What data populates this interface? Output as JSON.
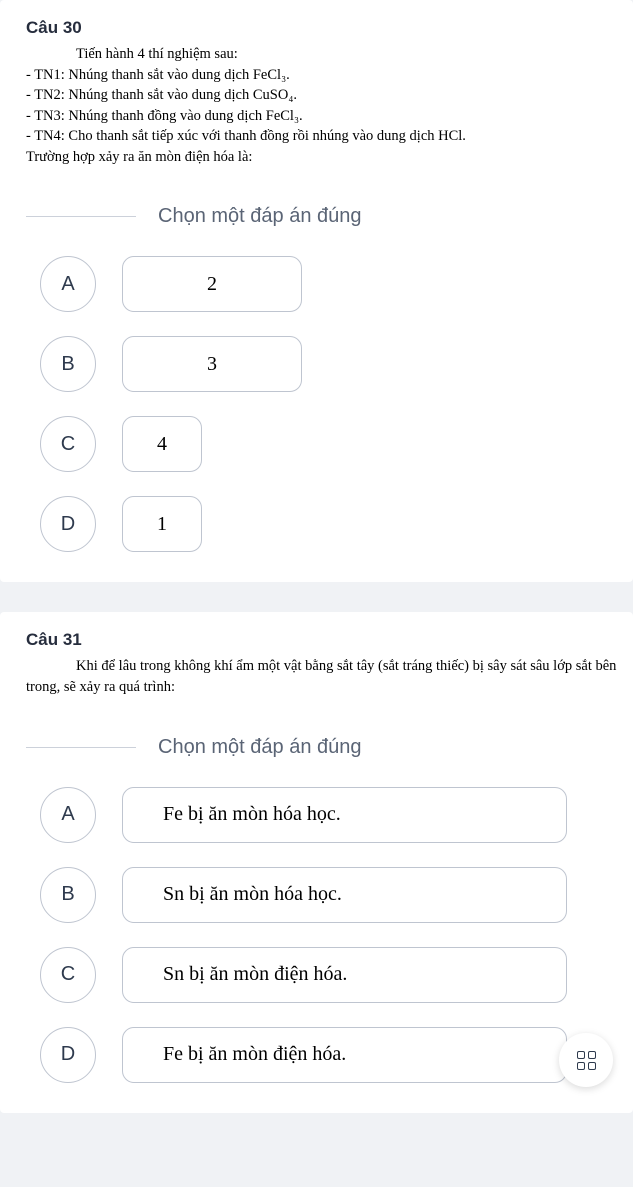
{
  "q30": {
    "title": "Câu 30",
    "intro": "Tiến hành 4 thí nghiệm sau:",
    "lines": [
      "- TN1: Nhúng thanh sắt vào dung dịch FeCl₃.",
      "- TN2: Nhúng thanh sắt vào dung dịch CuSO₄.",
      "- TN3: Nhúng thanh đồng vào dung dịch FeCl₃.",
      "- TN4: Cho thanh sắt tiếp xúc với thanh đồng rồi nhúng vào dung dịch HCl."
    ],
    "ask": "Trường hợp xảy ra ăn mòn điện hóa là:",
    "prompt": "Chọn một đáp án đúng",
    "options": [
      {
        "letter": "A",
        "value": "2"
      },
      {
        "letter": "B",
        "value": "3"
      },
      {
        "letter": "C",
        "value": "4"
      },
      {
        "letter": "D",
        "value": "1"
      }
    ]
  },
  "q31": {
    "title": "Câu 31",
    "body": "Khi để lâu trong không khí ẩm một vật bằng sắt tây (sắt tráng thiếc) bị sây sát sâu lớp sắt bên trong, sẽ xảy ra quá trình:",
    "prompt": "Chọn một đáp án đúng",
    "options": [
      {
        "letter": "A",
        "value": "Fe bị ăn mòn hóa học."
      },
      {
        "letter": "B",
        "value": "Sn bị ăn mòn hóa học."
      },
      {
        "letter": "C",
        "value": "Sn bị ăn mòn điện hóa."
      },
      {
        "letter": "D",
        "value": "Fe bị ăn mòn điện hóa."
      }
    ]
  }
}
